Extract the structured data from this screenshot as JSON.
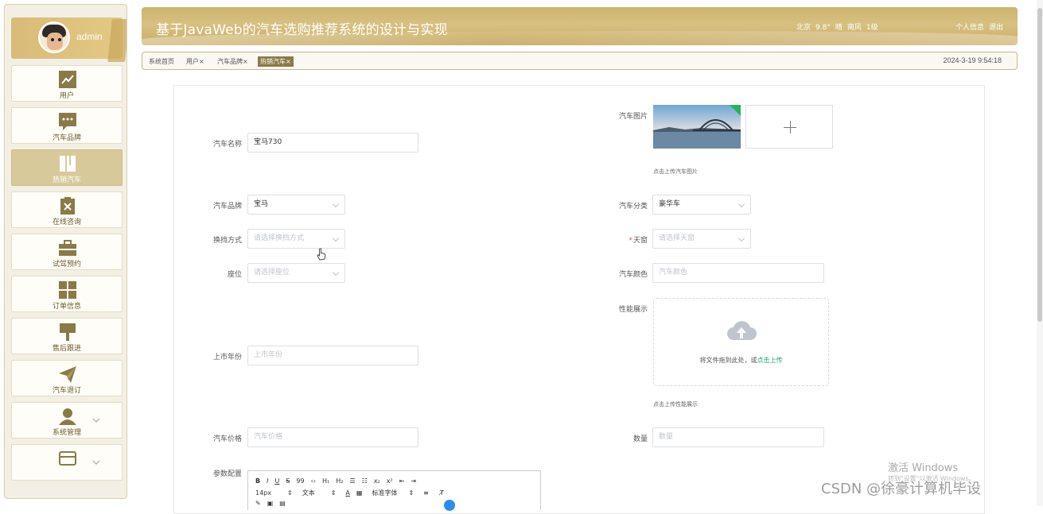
{
  "app": {
    "title": "基于JavaWeb的汽车选购推荐系统的设计与实现",
    "weather": [
      "北京",
      "9.8°",
      "晴",
      "南风",
      "1级"
    ],
    "links": [
      "个人信息",
      "退出"
    ],
    "datetime": "2024-3-19 9:54:18"
  },
  "user": {
    "name": "admin"
  },
  "sidebar": {
    "items": [
      {
        "label": "用户",
        "icon": "chart-icon"
      },
      {
        "label": "汽车品牌",
        "icon": "chat-icon"
      },
      {
        "label": "热销汽车",
        "icon": "book-icon",
        "active": true
      },
      {
        "label": "在线咨询",
        "icon": "clipboard-icon"
      },
      {
        "label": "试驾预约",
        "icon": "briefcase-icon"
      },
      {
        "label": "订单信息",
        "icon": "grid-icon"
      },
      {
        "label": "售后跟进",
        "icon": "brush-icon"
      },
      {
        "label": "汽车退订",
        "icon": "paper-plane-icon"
      },
      {
        "label": "系统管理",
        "icon": "user-icon"
      },
      {
        "label": "",
        "icon": "card-icon"
      }
    ]
  },
  "tabs": [
    "系统首页",
    "用户×",
    "汽车品牌×",
    "热销汽车×"
  ],
  "form": {
    "car_name": {
      "label": "汽车名称",
      "value": "宝马730"
    },
    "car_image": {
      "label": "汽车图片",
      "hint": "点击上传汽车图片"
    },
    "brand": {
      "label": "汽车品牌",
      "value": "宝马"
    },
    "category": {
      "label": "汽车分类",
      "value": "豪华车"
    },
    "gearbox": {
      "label": "换挡方式",
      "placeholder": "请选择换挡方式"
    },
    "sunroof": {
      "required": "*",
      "label": "天窗",
      "placeholder": "请选择天窗"
    },
    "seats": {
      "label": "座位",
      "placeholder": "请选择座位"
    },
    "color": {
      "label": "汽车颜色",
      "placeholder": "汽车颜色"
    },
    "performance": {
      "label": "性能展示",
      "drop_text": "将文件拖到此处，或",
      "drop_link": "点击上传",
      "hint": "点击上传性能展示"
    },
    "year": {
      "label": "上市年份",
      "placeholder": "上市年份"
    },
    "price": {
      "label": "汽车价格",
      "placeholder": "汽车价格"
    },
    "quantity": {
      "label": "数量",
      "placeholder": "数量"
    },
    "params": {
      "label": "参数配置"
    }
  },
  "editor": {
    "row1": [
      "B",
      "I",
      "U",
      "S",
      "99",
      "‹›",
      "H₁",
      "H₂",
      "☰",
      "☷",
      "x₂",
      "x²",
      "⇤",
      "⇥"
    ],
    "row2": [
      "14px",
      "⇕",
      "文本",
      "⇕",
      "A",
      "▦",
      "标准字体",
      "⇕",
      "≡",
      "T̸"
    ],
    "row3": [
      "✎",
      "▣",
      "▤"
    ]
  },
  "watermark": {
    "activate_title": "激活 Windows",
    "activate_sub": "转到\"设置\"以激活 Windows。",
    "csdn": "CSDN @徐豪计算机毕设"
  }
}
